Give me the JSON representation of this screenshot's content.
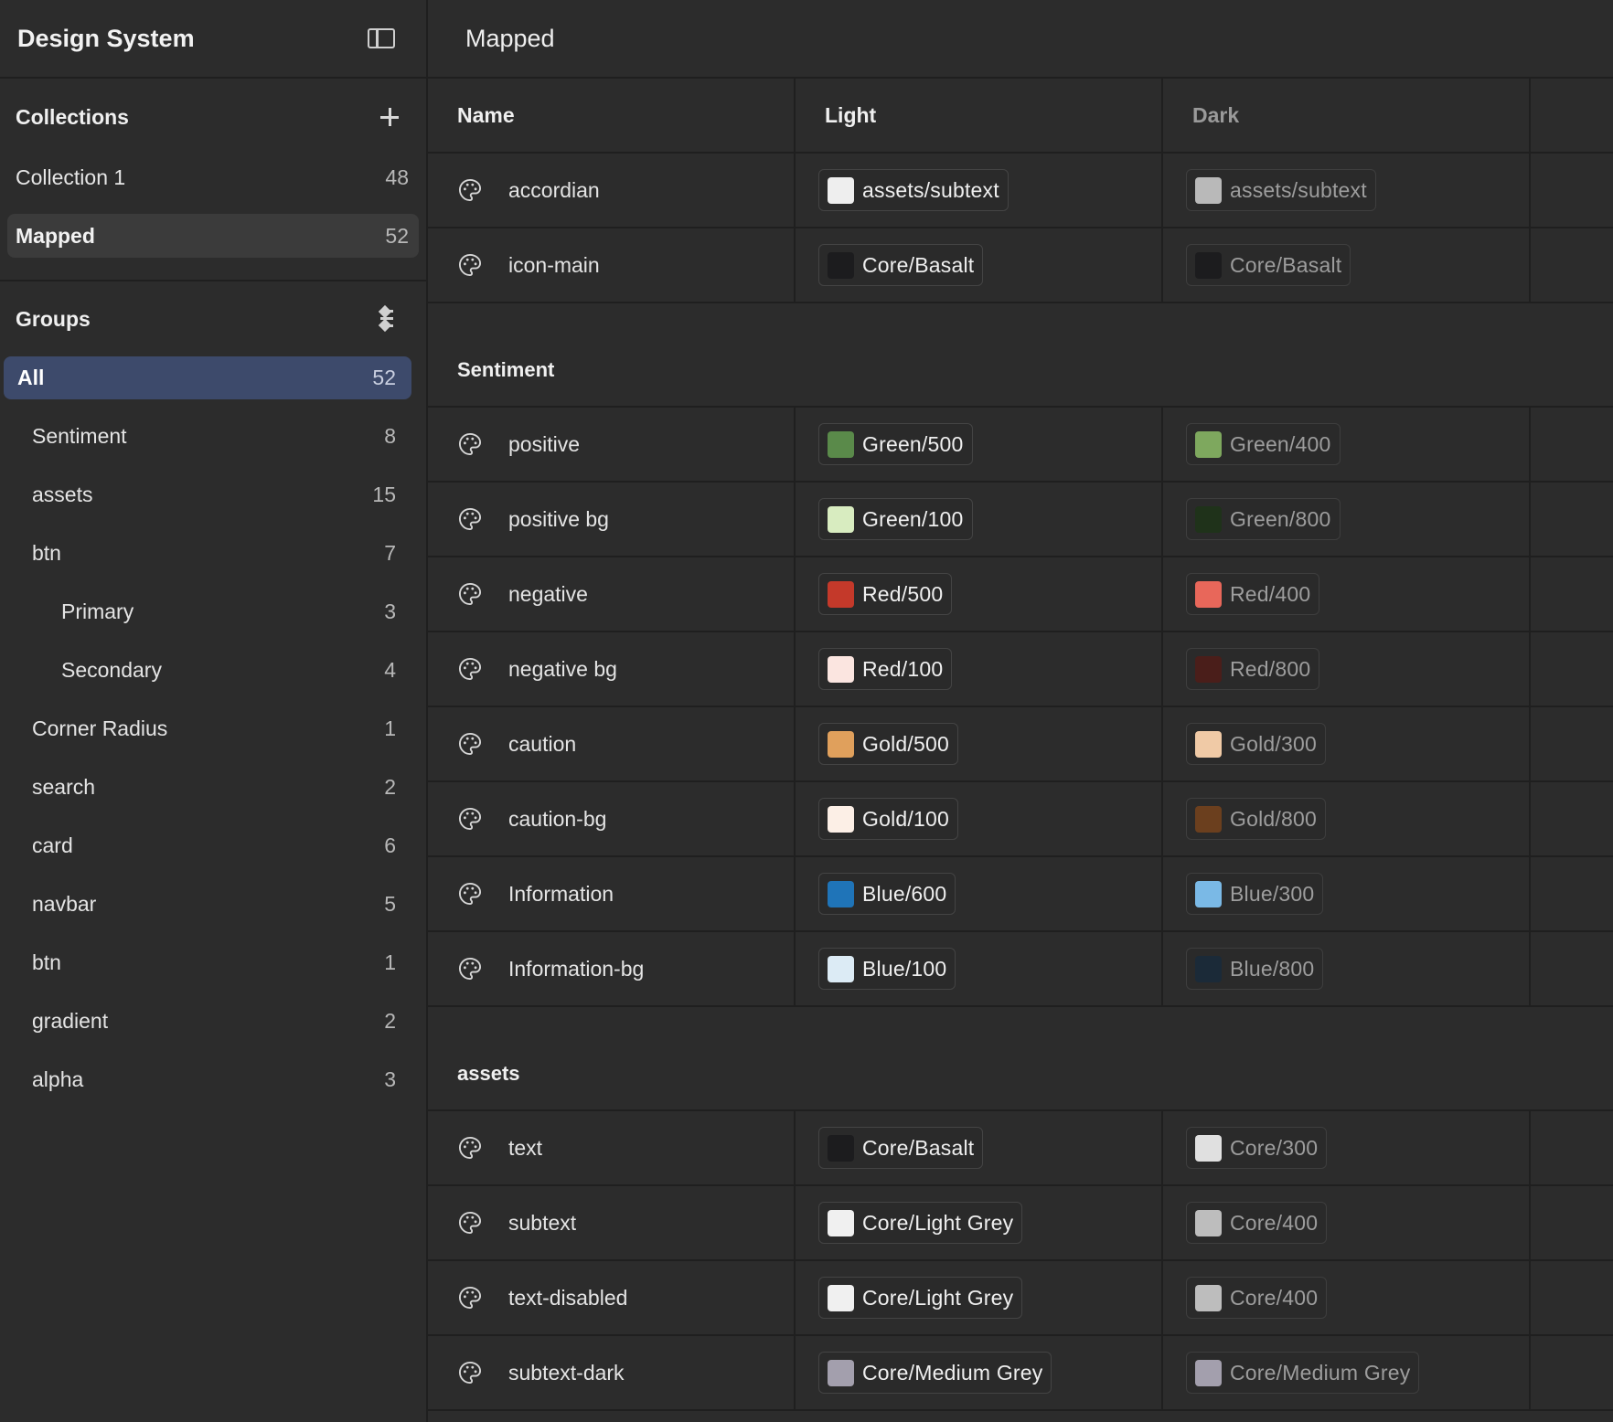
{
  "sidebar": {
    "title": "Design System",
    "collections_title": "Collections",
    "collections": [
      {
        "label": "Collection 1",
        "count": "48"
      },
      {
        "label": "Mapped",
        "count": "52"
      }
    ],
    "groups_title": "Groups",
    "groups": [
      {
        "label": "All",
        "count": "52"
      },
      {
        "label": "Sentiment",
        "count": "8"
      },
      {
        "label": "assets",
        "count": "15"
      },
      {
        "label": "btn",
        "count": "7"
      },
      {
        "label": "Primary",
        "count": "3"
      },
      {
        "label": "Secondary",
        "count": "4"
      },
      {
        "label": "Corner Radius",
        "count": "1"
      },
      {
        "label": "search",
        "count": "2"
      },
      {
        "label": "card",
        "count": "6"
      },
      {
        "label": "navbar",
        "count": "5"
      },
      {
        "label": "btn",
        "count": "1"
      },
      {
        "label": "gradient",
        "count": "2"
      },
      {
        "label": "alpha",
        "count": "3"
      }
    ]
  },
  "main": {
    "title": "Mapped",
    "columns": {
      "name": "Name",
      "light": "Light",
      "dark": "Dark"
    },
    "rows": [
      {
        "name": "accordian",
        "light": "assets/subtext",
        "light_color": "#eeeeee",
        "dark": "assets/subtext",
        "dark_color": "#b9b9b9"
      },
      {
        "name": "icon-main",
        "light": "Core/Basalt",
        "light_color": "#1c1c1e",
        "dark": "Core/Basalt",
        "dark_color": "#1c1c1e"
      }
    ],
    "groups": [
      {
        "title": "Sentiment",
        "rows": [
          {
            "name": "positive",
            "light": "Green/500",
            "light_color": "#5a8a4a",
            "dark": "Green/400",
            "dark_color": "#7ea85e"
          },
          {
            "name": "positive bg",
            "light": "Green/100",
            "light_color": "#d8ecc0",
            "dark": "Green/800",
            "dark_color": "#1f321a"
          },
          {
            "name": "negative",
            "light": "Red/500",
            "light_color": "#c4392a",
            "dark": "Red/400",
            "dark_color": "#e8675a"
          },
          {
            "name": "negative bg",
            "light": "Red/100",
            "light_color": "#fbe5e0",
            "dark": "Red/800",
            "dark_color": "#4a1e1a"
          },
          {
            "name": "caution",
            "light": "Gold/500",
            "light_color": "#e0a05c",
            "dark": "Gold/300",
            "dark_color": "#f0caa6"
          },
          {
            "name": "caution-bg",
            "light": "Gold/100",
            "light_color": "#fcefe6",
            "dark": "Gold/800",
            "dark_color": "#6b3f1e"
          },
          {
            "name": "Information",
            "light": "Blue/600",
            "light_color": "#1f74b8",
            "dark": "Blue/300",
            "dark_color": "#7ab9e6"
          },
          {
            "name": "Information-bg",
            "light": "Blue/100",
            "light_color": "#dcebf5",
            "dark": "Blue/800",
            "dark_color": "#1b2a38"
          }
        ]
      },
      {
        "title": "assets",
        "rows": [
          {
            "name": "text",
            "light": "Core/Basalt",
            "light_color": "#1c1c1e",
            "dark": "Core/300",
            "dark_color": "#e0e0e0"
          },
          {
            "name": "subtext",
            "light": "Core/Light Grey",
            "light_color": "#f0f0f0",
            "dark": "Core/400",
            "dark_color": "#bdbdbd"
          },
          {
            "name": "text-disabled",
            "light": "Core/Light Grey",
            "light_color": "#f0f0f0",
            "dark": "Core/400",
            "dark_color": "#bdbdbd"
          },
          {
            "name": "subtext-dark",
            "light": "Core/Medium Grey",
            "light_color": "#a39fad",
            "dark": "Core/Medium Grey",
            "dark_color": "#a39fad"
          }
        ]
      }
    ]
  }
}
